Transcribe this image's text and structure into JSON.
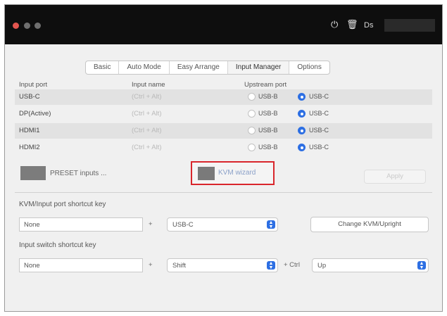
{
  "titlebar": {
    "icons": [
      "power-icon",
      "trash-icon"
    ],
    "label": "Ds"
  },
  "tabs": [
    {
      "label": "Basic",
      "active": false
    },
    {
      "label": "Auto Mode",
      "active": false
    },
    {
      "label": "Easy Arrange",
      "active": false
    },
    {
      "label": "Input Manager",
      "active": true
    },
    {
      "label": "Options",
      "active": false
    }
  ],
  "table": {
    "headers": [
      "Input port",
      "Input name",
      "Upstream port"
    ],
    "rows": [
      {
        "port": "USB-C",
        "name": "(Ctrl + Alt)",
        "option_a": "USB-B",
        "option_b": "USB-C",
        "selected": "USB-C"
      },
      {
        "port": "DP(Active)",
        "name": "(Ctrl + Alt)",
        "option_a": "USB-B",
        "option_b": "USB-C",
        "selected": "USB-C"
      },
      {
        "port": "HDMI1",
        "name": "(Ctrl + Alt)",
        "option_a": "USB-B",
        "option_b": "USB-C",
        "selected": "USB-C"
      },
      {
        "port": "HDMI2",
        "name": "(Ctrl + Alt)",
        "option_a": "USB-B",
        "option_b": "USB-C",
        "selected": "USB-C"
      }
    ]
  },
  "preset_label": "PRESET inputs ...",
  "wizard_label": "KVM wizard",
  "apply_label": "Apply",
  "kvm_shortcut": {
    "label": "KVM/Input port shortcut key",
    "key_value": "None",
    "separator": "+",
    "port_value": "USB-C",
    "button_label": "Change KVM/Upright"
  },
  "input_shortcut": {
    "label": "Input switch shortcut key",
    "key_value": "None",
    "separator": "+",
    "mod_value": "Shift",
    "separator2": "+ Ctrl",
    "dir_value": "Up"
  },
  "accent_color": "#2d6fe3",
  "highlight_color": "#d9262c"
}
